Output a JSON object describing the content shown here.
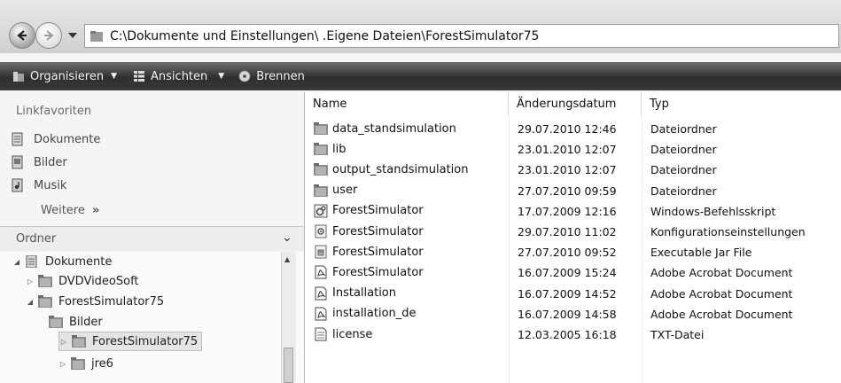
{
  "address_bar": {
    "path": "C:\\Dokumente und Einstellungen\\ .Eigene Dateien\\ForestSimulator75"
  },
  "toolbar": {
    "organize": "Organisieren",
    "views": "Ansichten",
    "burn": "Brennen"
  },
  "navigation": {
    "favorites_header": "Linkfavoriten",
    "favorites": [
      {
        "label": "Dokumente",
        "icon": "documents-icon"
      },
      {
        "label": "Bilder",
        "icon": "pictures-icon"
      },
      {
        "label": "Musik",
        "icon": "music-icon"
      }
    ],
    "more": "Weitere",
    "more_glyph": "»",
    "folders_header": "Ordner",
    "tree": [
      {
        "label": "Dokumente",
        "level": 0,
        "expander": "expanded",
        "icon": "documents-icon"
      },
      {
        "label": "DVDVideoSoft",
        "level": 1,
        "expander": "collapsed",
        "icon": "folder-icon"
      },
      {
        "label": "ForestSimulator75",
        "level": 1,
        "expander": "expanded",
        "icon": "folder-icon"
      },
      {
        "label": "Bilder",
        "level": 2,
        "expander": "none",
        "icon": "folder-icon"
      },
      {
        "label": "ForestSimulator75",
        "level": 2,
        "expander": "collapsed",
        "icon": "folder-icon",
        "selected": true
      },
      {
        "label": "jre6",
        "level": 1,
        "expander": "collapsed",
        "icon": "folder-icon"
      }
    ]
  },
  "file_list": {
    "columns": [
      "Name",
      "Änderungsdatum",
      "Typ"
    ],
    "rows": [
      {
        "name": "data_standsimulation",
        "date": "29.07.2010 12:46",
        "type": "Dateiordner",
        "icon": "folder-icon"
      },
      {
        "name": "lib",
        "date": "23.01.2010 12:07",
        "type": "Dateiordner",
        "icon": "folder-icon"
      },
      {
        "name": "output_standsimulation",
        "date": "23.01.2010 12:07",
        "type": "Dateiordner",
        "icon": "folder-icon"
      },
      {
        "name": "user",
        "date": "27.07.2010 09:59",
        "type": "Dateiordner",
        "icon": "folder-icon"
      },
      {
        "name": "ForestSimulator",
        "date": "17.07.2009 12:16",
        "type": "Windows-Befehlsskript",
        "icon": "batch-script-icon"
      },
      {
        "name": "ForestSimulator",
        "date": "29.07.2010 11:02",
        "type": "Konfigurationseinstellungen",
        "icon": "config-file-icon"
      },
      {
        "name": "ForestSimulator",
        "date": "27.07.2010 09:52",
        "type": "Executable Jar File",
        "icon": "jar-file-icon"
      },
      {
        "name": "ForestSimulator",
        "date": "16.07.2009 15:24",
        "type": "Adobe Acrobat Document",
        "icon": "pdf-icon"
      },
      {
        "name": "Installation",
        "date": "16.07.2009 14:52",
        "type": "Adobe Acrobat Document",
        "icon": "pdf-icon"
      },
      {
        "name": "installation_de",
        "date": "16.07.2009 14:58",
        "type": "Adobe Acrobat Document",
        "icon": "pdf-icon"
      },
      {
        "name": "license",
        "date": "12.03.2005 16:18",
        "type": "TXT-Datei",
        "icon": "text-file-icon"
      }
    ]
  }
}
